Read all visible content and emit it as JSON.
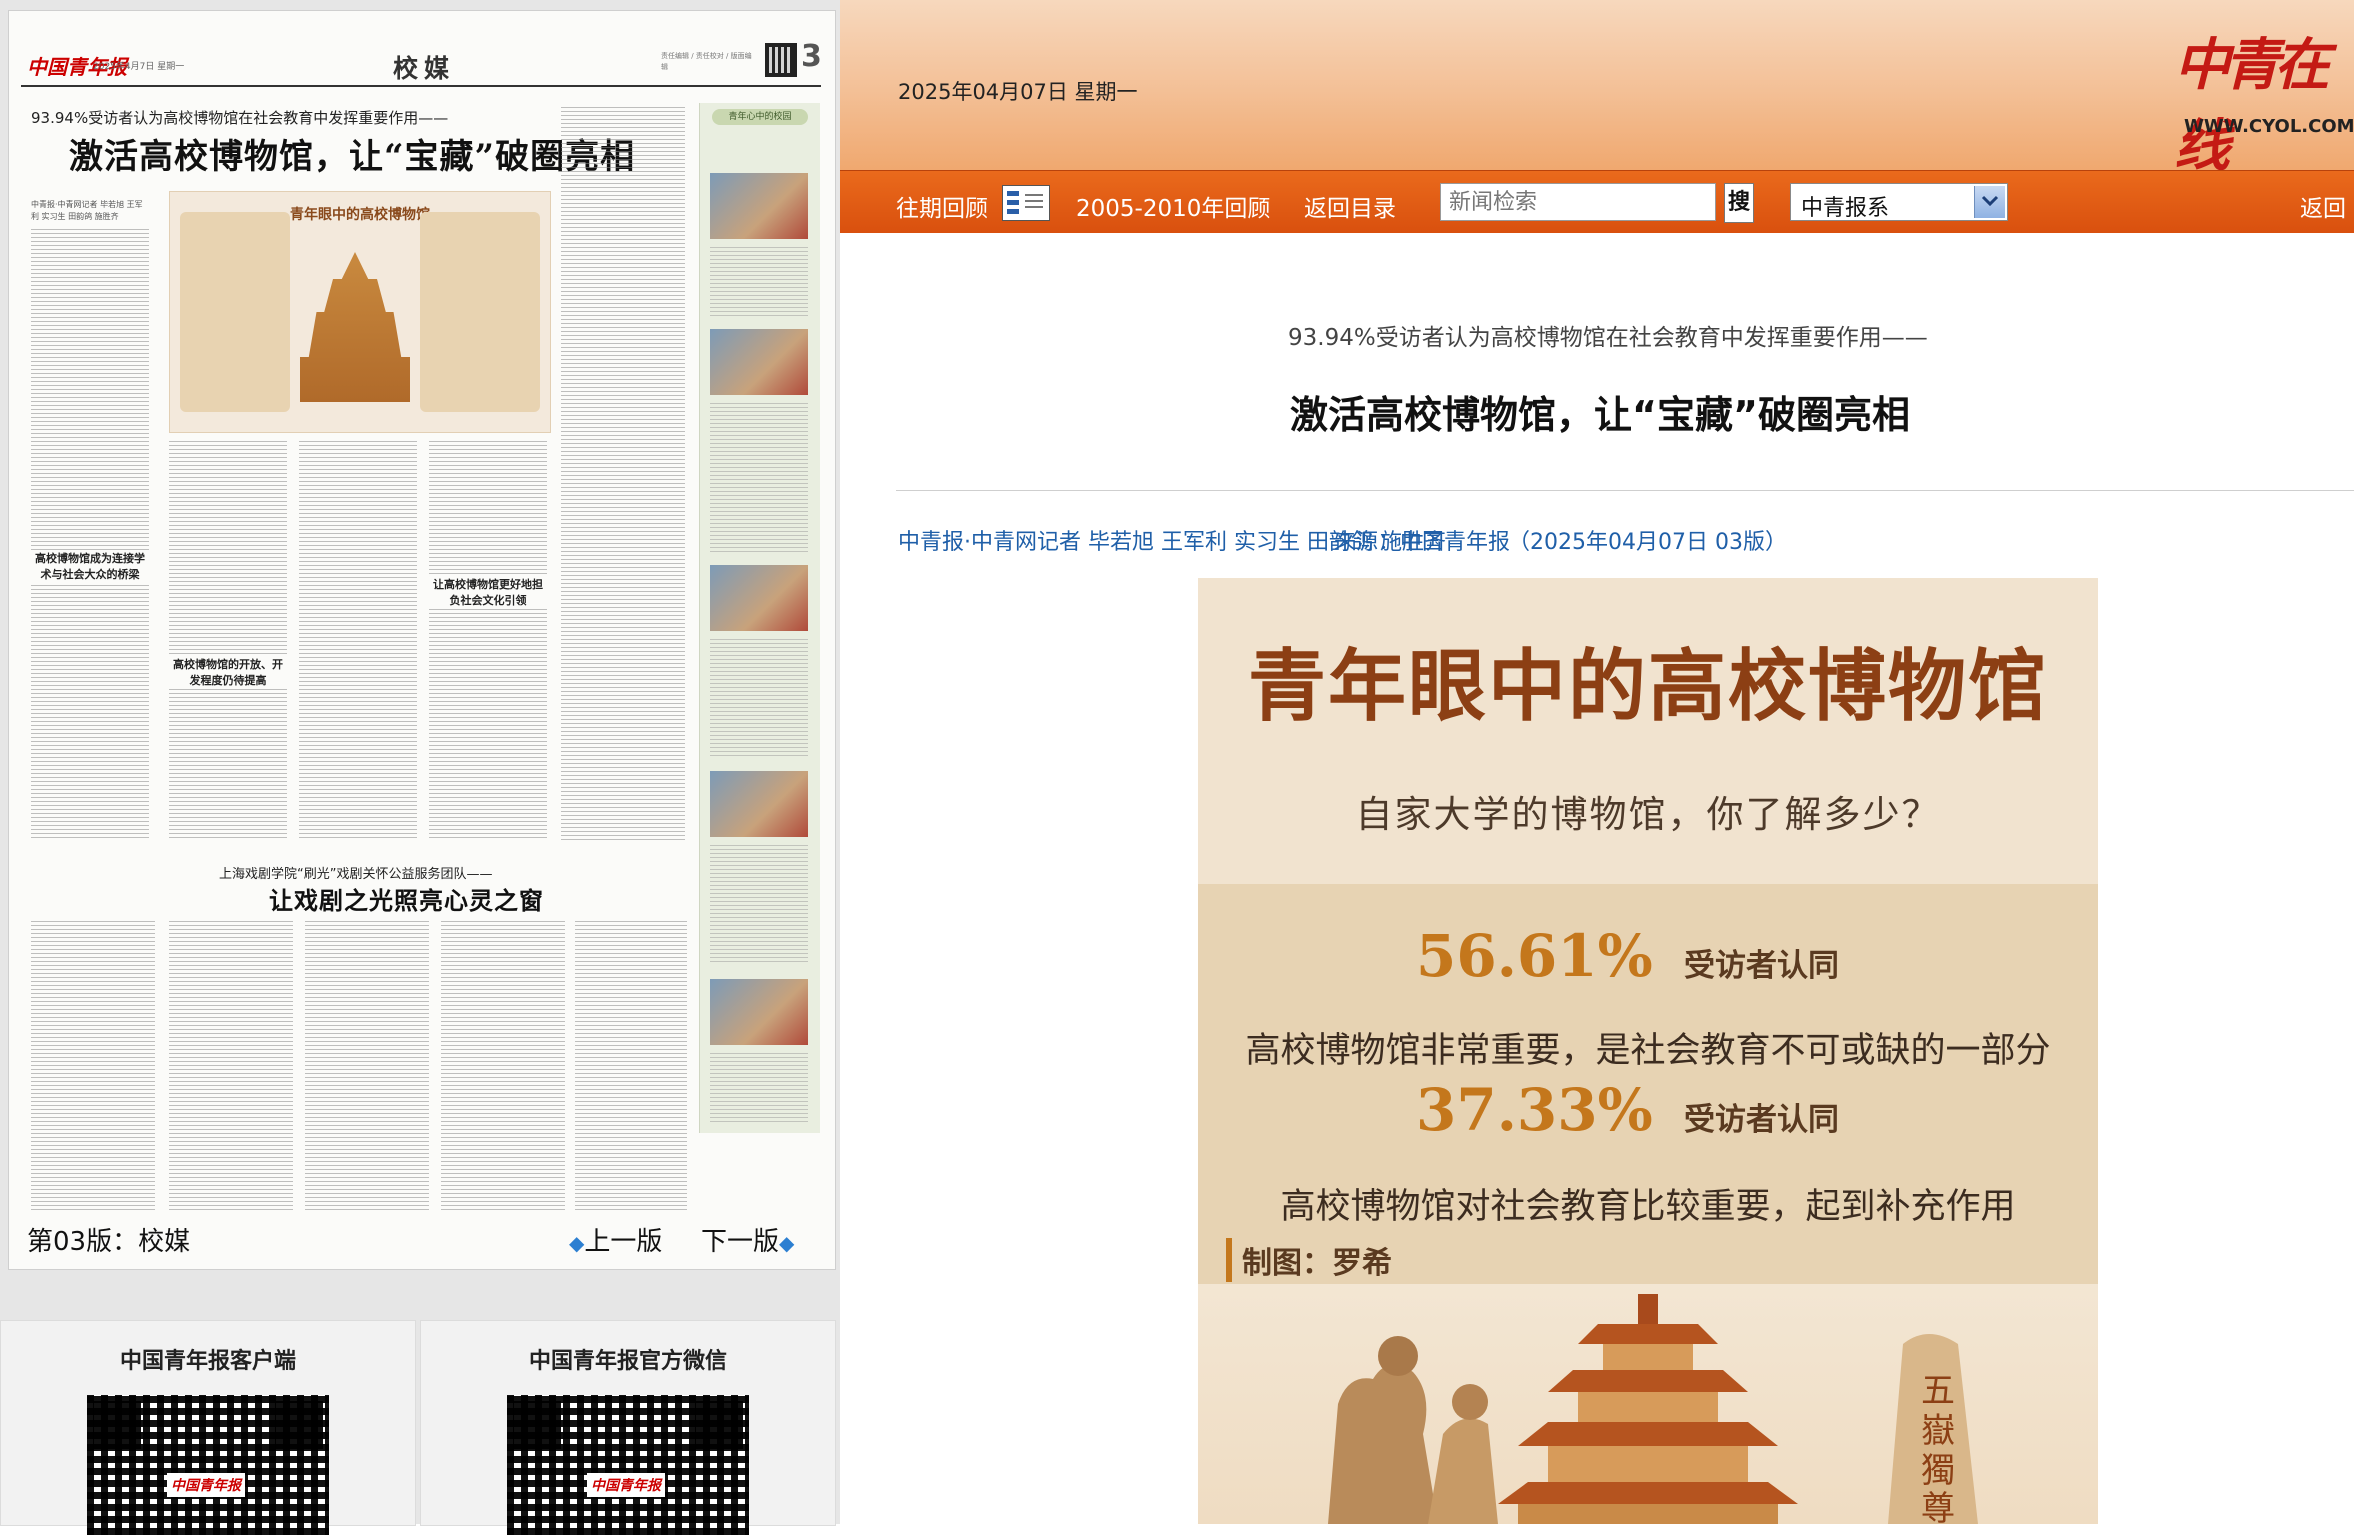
{
  "newspaper": {
    "logo_text": "中国青年报",
    "date_line": "2025年4月7日 星期一",
    "section_name": "校媒",
    "page_number": "3",
    "editors_text": "责任编辑 / 责任校对 / 版面编辑",
    "kicker": "93.94%受访者认为高校博物馆在社会教育中发挥重要作用——",
    "headline": "激活高校博物馆，让“宝藏”破圈亮相",
    "byline": "中青报·中青网记者 毕若旭 王军利 实习生 田韵鸽 施胜齐",
    "infographic_title": "青年眼中的高校博物馆",
    "column_heads": [
      "高校博物馆成为连接学术与社会大众的桥梁",
      "高校博物馆的开放、开发程度仍待提高",
      "让高校博物馆更好地担负社会文化引领"
    ],
    "sidebar_label": "青年心中的校园",
    "second_kicker": "上海戏剧学院“刷光”戏剧关怀公益服务团队——",
    "second_headline": "让戏剧之光照亮心灵之窗",
    "footer_page_label": "第03版：校媒",
    "prev_label": "上一版",
    "next_label": "下一版"
  },
  "qr_blocks": [
    {
      "title": "中国青年报客户端"
    },
    {
      "title": "中国青年报官方微信"
    }
  ],
  "header": {
    "date": "2025年04月07日  星期一",
    "logo_text": "中青在线",
    "url": "WWW.CYOL.COM"
  },
  "nav": {
    "past_review": "往期回顾",
    "archive_2005_2010": "2005-2010年回顾",
    "back_to_index": "返回目录",
    "search_placeholder": "新闻检索",
    "search_button": "搜",
    "selected_paper": "中青报系",
    "back_home": "返回"
  },
  "article": {
    "kicker": "93.94%受访者认为高校博物馆在社会教育中发挥重要作用——",
    "title": "激活高校博物馆，让“宝藏”破圈亮相",
    "authors": "中青报·中青网记者 毕若旭 王军利 实习生 田韵鸽 施胜齐",
    "source": "来源：中国青年报",
    "date_page": "（2025年04月07日  03版）"
  },
  "illustration": {
    "title": "青年眼中的高校博物馆",
    "subtitle": "自家大学的博物馆，你了解多少？",
    "stat1_value": "56.61%",
    "stat1_label": "受访者认同",
    "stat1_desc": "高校博物馆非常重要，是社会教育不可或缺的一部分",
    "stat2_value": "37.33%",
    "stat2_label": "受访者认同",
    "stat2_desc": "高校博物馆对社会教育比较重要，起到补充作用",
    "credit": "制图：罗希",
    "stele_text": "五嶽獨尊"
  },
  "colors": {
    "nav_orange": "#d9500e",
    "brand_red": "#c41a14",
    "link_blue": "#1f5fa8"
  }
}
